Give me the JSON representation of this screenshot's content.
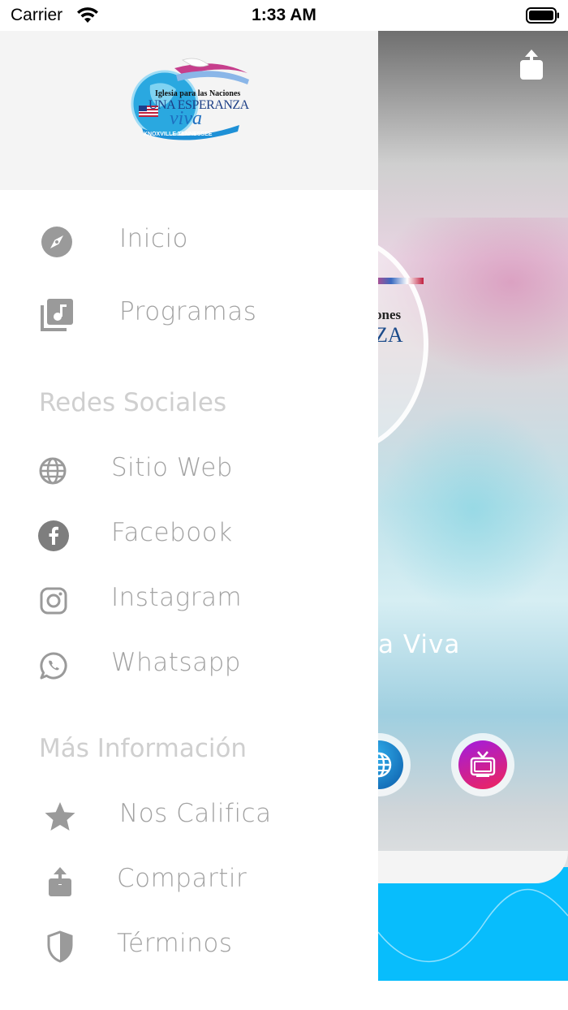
{
  "status_bar": {
    "carrier": "Carrier",
    "time": "1:33 AM"
  },
  "logo": {
    "line1": "Iglesia para las Naciones",
    "line2": "UNA ESPERANZA",
    "line3": "viva",
    "line4": "KNOXVILLE TENNESSEE"
  },
  "menu": {
    "main_items": [
      {
        "label": "Inicio",
        "icon": "compass-icon"
      },
      {
        "label": "Programas",
        "icon": "music-library-icon"
      }
    ],
    "social_header": "Redes Sociales",
    "social_items": [
      {
        "label": "Sitio  Web",
        "icon": "globe-icon"
      },
      {
        "label": "Facebook",
        "icon": "facebook-icon"
      },
      {
        "label": "Instagram",
        "icon": "instagram-icon"
      },
      {
        "label": "Whatsapp",
        "icon": "whatsapp-icon"
      }
    ],
    "info_header": "Más Información",
    "info_items": [
      {
        "label": "Nos  Califica",
        "icon": "star-icon"
      },
      {
        "label": "Compartir",
        "icon": "share-icon"
      },
      {
        "label": "Términos",
        "icon": "shield-icon"
      }
    ]
  },
  "background_app": {
    "title_fragment": "a  Viva",
    "logo_fragment_1": "ones",
    "logo_fragment_2": "ZA"
  },
  "colors": {
    "accent_blue": "#08bdfc",
    "menu_text": "#a2a2a2",
    "section_text": "#cfcfcf",
    "header_bg": "#f4f4f4"
  }
}
